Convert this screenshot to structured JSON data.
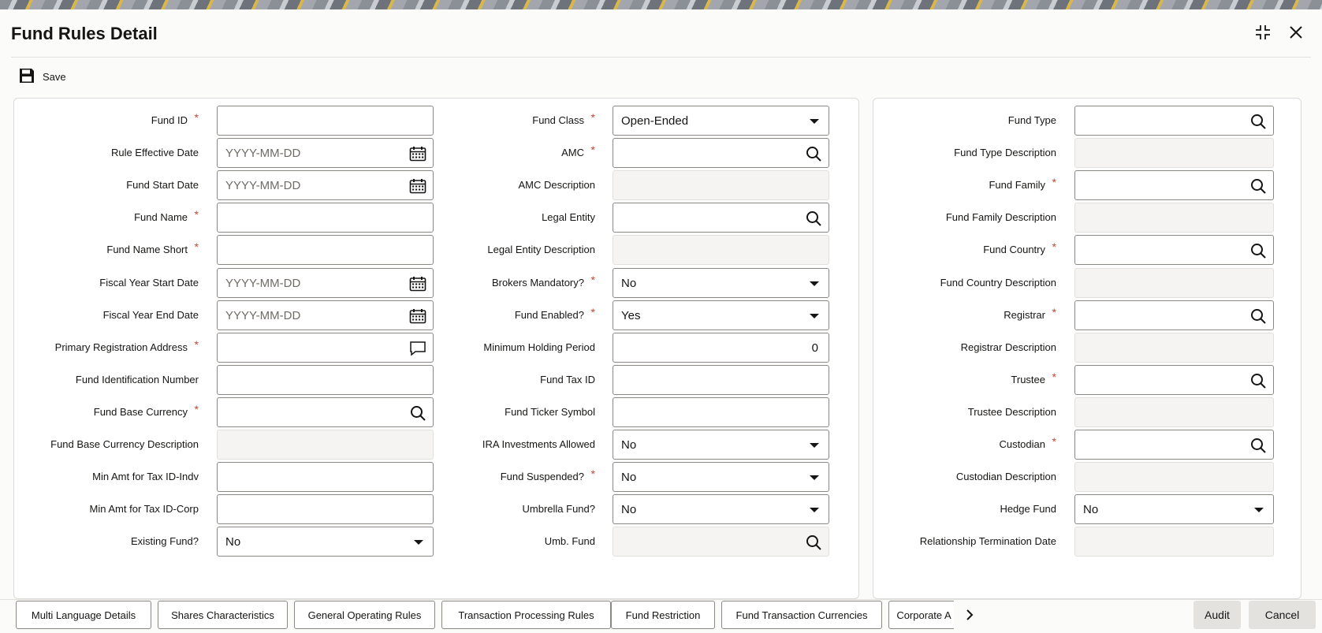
{
  "app": {
    "title": "Fund Rules Detail"
  },
  "toolbar": {
    "save_label": "Save"
  },
  "section1": {
    "col1": [
      {
        "label": "Fund ID",
        "required": true,
        "type": "text",
        "value": ""
      },
      {
        "label": "Rule Effective Date",
        "required": false,
        "type": "date",
        "placeholder": "YYYY-MM-DD"
      },
      {
        "label": "Fund Start Date",
        "required": false,
        "type": "date",
        "placeholder": "YYYY-MM-DD"
      },
      {
        "label": "Fund Name",
        "required": true,
        "type": "text",
        "value": ""
      },
      {
        "label": "Fund Name Short",
        "required": true,
        "type": "text",
        "value": ""
      },
      {
        "label": "Fiscal Year Start Date",
        "required": false,
        "type": "date",
        "placeholder": "YYYY-MM-DD"
      },
      {
        "label": "Fiscal Year End Date",
        "required": false,
        "type": "date",
        "placeholder": "YYYY-MM-DD"
      },
      {
        "label": "Primary Registration Address",
        "required": true,
        "type": "textarea",
        "value": ""
      },
      {
        "label": "Fund Identification Number",
        "required": false,
        "type": "text",
        "value": ""
      },
      {
        "label": "Fund Base Currency",
        "required": true,
        "type": "lookup",
        "value": ""
      },
      {
        "label": "Fund Base Currency Description",
        "required": false,
        "type": "readonly",
        "value": ""
      },
      {
        "label": "Min Amt for Tax ID-Indv",
        "required": false,
        "type": "text",
        "value": ""
      },
      {
        "label": "Min Amt for Tax ID-Corp",
        "required": false,
        "type": "text",
        "value": ""
      },
      {
        "label": "Existing Fund?",
        "required": false,
        "type": "select",
        "value": "No"
      }
    ],
    "col2": [
      {
        "label": "Fund Class",
        "required": true,
        "type": "select",
        "value": "Open-Ended"
      },
      {
        "label": "AMC",
        "required": true,
        "type": "lookup",
        "value": ""
      },
      {
        "label": "AMC Description",
        "required": false,
        "type": "readonly",
        "value": ""
      },
      {
        "label": "Legal Entity",
        "required": false,
        "type": "lookup",
        "value": ""
      },
      {
        "label": "Legal Entity Description",
        "required": false,
        "type": "readonly",
        "value": ""
      },
      {
        "label": "Brokers Mandatory?",
        "required": true,
        "type": "select",
        "value": "No"
      },
      {
        "label": "Fund Enabled?",
        "required": true,
        "type": "select",
        "value": "Yes"
      },
      {
        "label": "Minimum Holding Period",
        "required": false,
        "type": "number",
        "value": "0"
      },
      {
        "label": "Fund Tax ID",
        "required": false,
        "type": "text",
        "value": ""
      },
      {
        "label": "Fund Ticker Symbol",
        "required": false,
        "type": "text",
        "value": ""
      },
      {
        "label": "IRA Investments Allowed",
        "required": false,
        "type": "select",
        "value": "No"
      },
      {
        "label": "Fund Suspended?",
        "required": true,
        "type": "select",
        "value": "No"
      },
      {
        "label": "Umbrella Fund?",
        "required": false,
        "type": "select",
        "value": "No"
      },
      {
        "label": "Umb. Fund",
        "required": false,
        "type": "readonly-lookup",
        "value": ""
      }
    ]
  },
  "section2": {
    "col1": [
      {
        "label": "Fund Type",
        "required": false,
        "type": "lookup",
        "value": ""
      },
      {
        "label": "Fund Type Description",
        "required": false,
        "type": "readonly",
        "value": ""
      },
      {
        "label": "Fund Family",
        "required": true,
        "type": "lookup",
        "value": ""
      },
      {
        "label": "Fund Family Description",
        "required": false,
        "type": "readonly",
        "value": ""
      },
      {
        "label": "Fund Country",
        "required": true,
        "type": "lookup",
        "value": ""
      },
      {
        "label": "Fund Country Description",
        "required": false,
        "type": "readonly",
        "value": ""
      },
      {
        "label": "Registrar",
        "required": true,
        "type": "lookup",
        "value": ""
      },
      {
        "label": "Registrar Description",
        "required": false,
        "type": "readonly",
        "value": ""
      },
      {
        "label": "Trustee",
        "required": true,
        "type": "lookup",
        "value": ""
      },
      {
        "label": "Trustee Description",
        "required": false,
        "type": "readonly",
        "value": ""
      },
      {
        "label": "Custodian",
        "required": true,
        "type": "lookup",
        "value": ""
      },
      {
        "label": "Custodian Description",
        "required": false,
        "type": "readonly",
        "value": ""
      },
      {
        "label": "Hedge Fund",
        "required": false,
        "type": "select",
        "value": "No"
      },
      {
        "label": "Relationship Termination Date",
        "required": false,
        "type": "readonly",
        "value": ""
      }
    ]
  },
  "bottom_tabs": [
    {
      "label": "Multi Language Details"
    },
    {
      "label": "Shares Characteristics"
    },
    {
      "label": "General Operating Rules"
    },
    {
      "label": "Transaction Processing Rules"
    },
    {
      "label": "Fund Restriction"
    },
    {
      "label": "Fund Transaction Currencies"
    },
    {
      "label": "Corporate A"
    }
  ],
  "actions": {
    "audit_label": "Audit",
    "cancel_label": "Cancel"
  },
  "colors": {
    "required": "#c74634",
    "accent": "#161513"
  }
}
